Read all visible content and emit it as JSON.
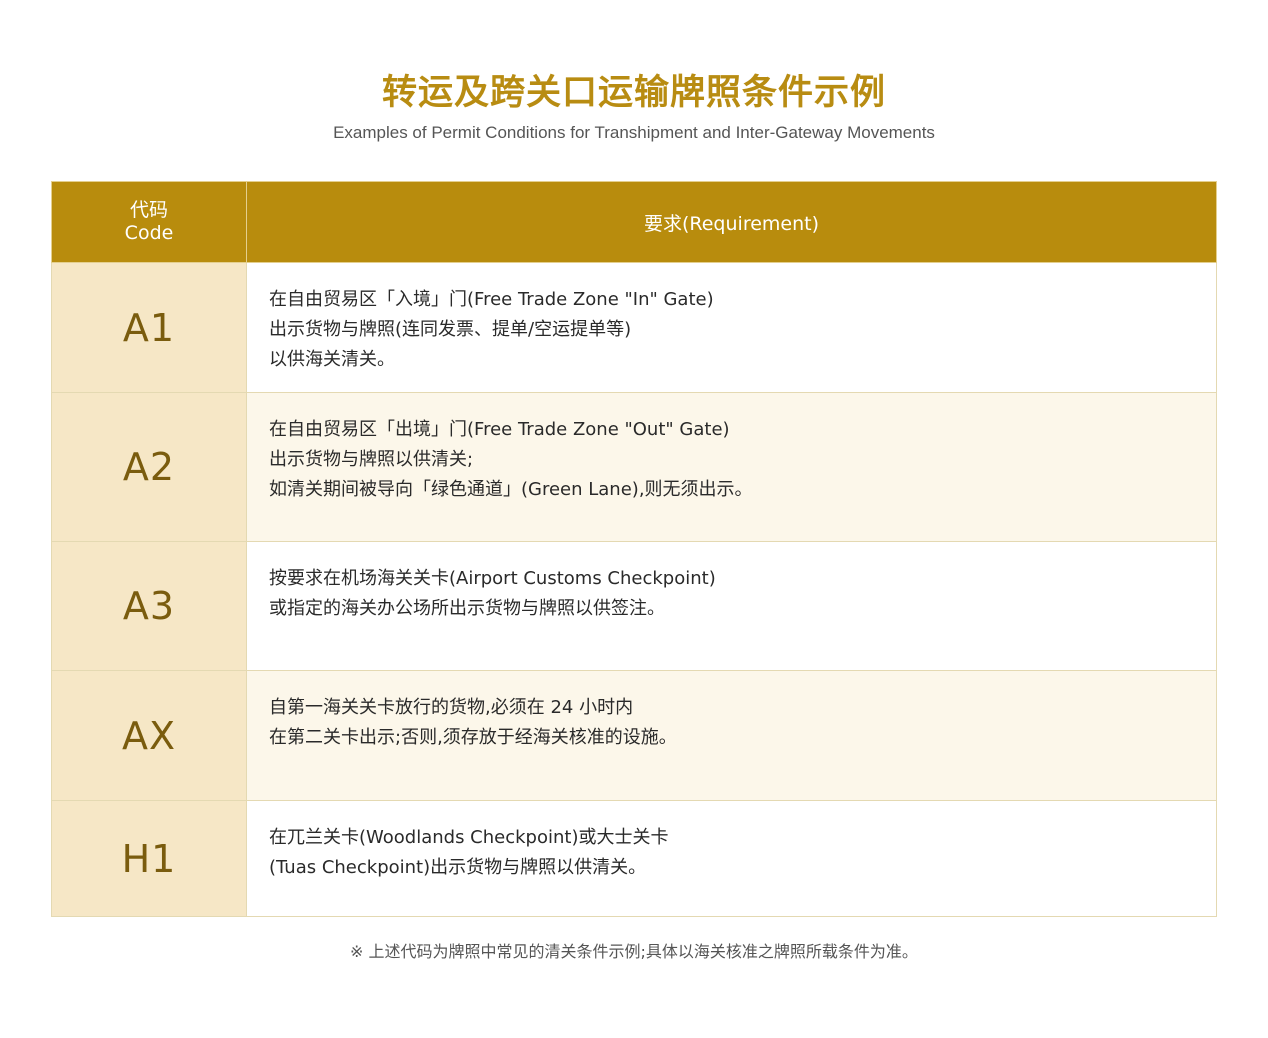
{
  "title": "转运及跨关口运输牌照条件示例",
  "subtitle": "Examples of Permit Conditions for Transhipment and Inter-Gateway Movements",
  "table": {
    "header": {
      "code_zh": "代码",
      "code_en": "Code",
      "requirement": "要求(Requirement)"
    },
    "rows": [
      {
        "code": "A1",
        "lines": [
          "在自由贸易区「入境」门(Free Trade Zone \"In\" Gate)",
          "出示货物与牌照(连同发票、提单/空运提单等)",
          "以供海关清关。"
        ]
      },
      {
        "code": "A2",
        "lines": [
          "在自由贸易区「出境」门(Free Trade Zone \"Out\" Gate)",
          "出示货物与牌照以供清关;",
          "如清关期间被导向「绿色通道」(Green Lane),则无须出示。"
        ]
      },
      {
        "code": "A3",
        "lines": [
          "按要求在机场海关关卡(Airport Customs Checkpoint)",
          "或指定的海关办公场所出示货物与牌照以供签注。"
        ]
      },
      {
        "code": "AX",
        "lines": [
          "自第一海关关卡放行的货物,必须在 24 小时内",
          "在第二关卡出示;否则,须存放于经海关核准的设施。"
        ]
      },
      {
        "code": "H1",
        "lines": [
          "在兀兰关卡(Woodlands Checkpoint)或大士关卡",
          "(Tuas Checkpoint)出示货物与牌照以供清关。"
        ]
      }
    ]
  },
  "footnote": "※ 上述代码为牌照中常见的清关条件示例;具体以海关核准之牌照所载条件为准。",
  "colors": {
    "accent_gold": "#b88c0d",
    "code_cell_bg": "#f6e7c6",
    "code_text": "#7a5c0e"
  }
}
